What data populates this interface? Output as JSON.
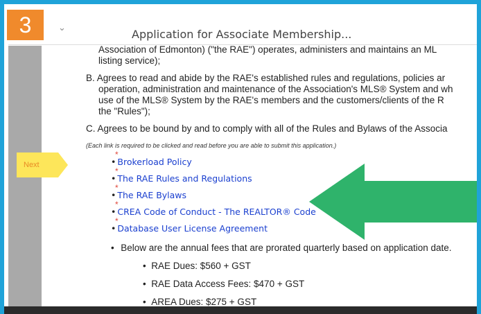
{
  "header": {
    "step_number": "3",
    "document_title": "Application for Associate Membership..."
  },
  "body": {
    "para_a_tail": "Association of Edmonton) (\"the RAE\") operates, administers and maintains an ML",
    "para_a_tail2": "listing service);",
    "para_b_1": "B. Agrees to read and abide by the RAE's established rules and regulations, policies ar",
    "para_b_2": "operation, administration and maintenance of the Association's MLS® System and wh",
    "para_b_3": "use of the MLS® System by the RAE's members and the customers/clients of the R",
    "para_b_4": "the \"Rules\");",
    "para_c": "C. Agrees to be bound by and to comply with all of the Rules and Bylaws of the Associa",
    "note": "(Each link is required to be clicked and read before you are able to submit this application.)",
    "links": [
      "Brokerload Policy",
      "The RAE Rules and Regulations",
      "The RAE Bylaws",
      "CREA Code of Conduct - The REALTOR® Code",
      "Database User License Agreement"
    ],
    "fees_intro": "Below are the annual fees that are prorated quarterly based on application date.",
    "fees": [
      "RAE Dues: $560 + GST",
      "RAE Data Access Fees: $470 + GST",
      "AREA Dues: $275 + GST"
    ]
  },
  "callout": {
    "next_label": "Next"
  },
  "colors": {
    "frame": "#1fa3d9",
    "badge": "#f08a2c",
    "arrow": "#2fb36b",
    "link": "#1a3fcf",
    "next_tag": "#fde65a"
  }
}
